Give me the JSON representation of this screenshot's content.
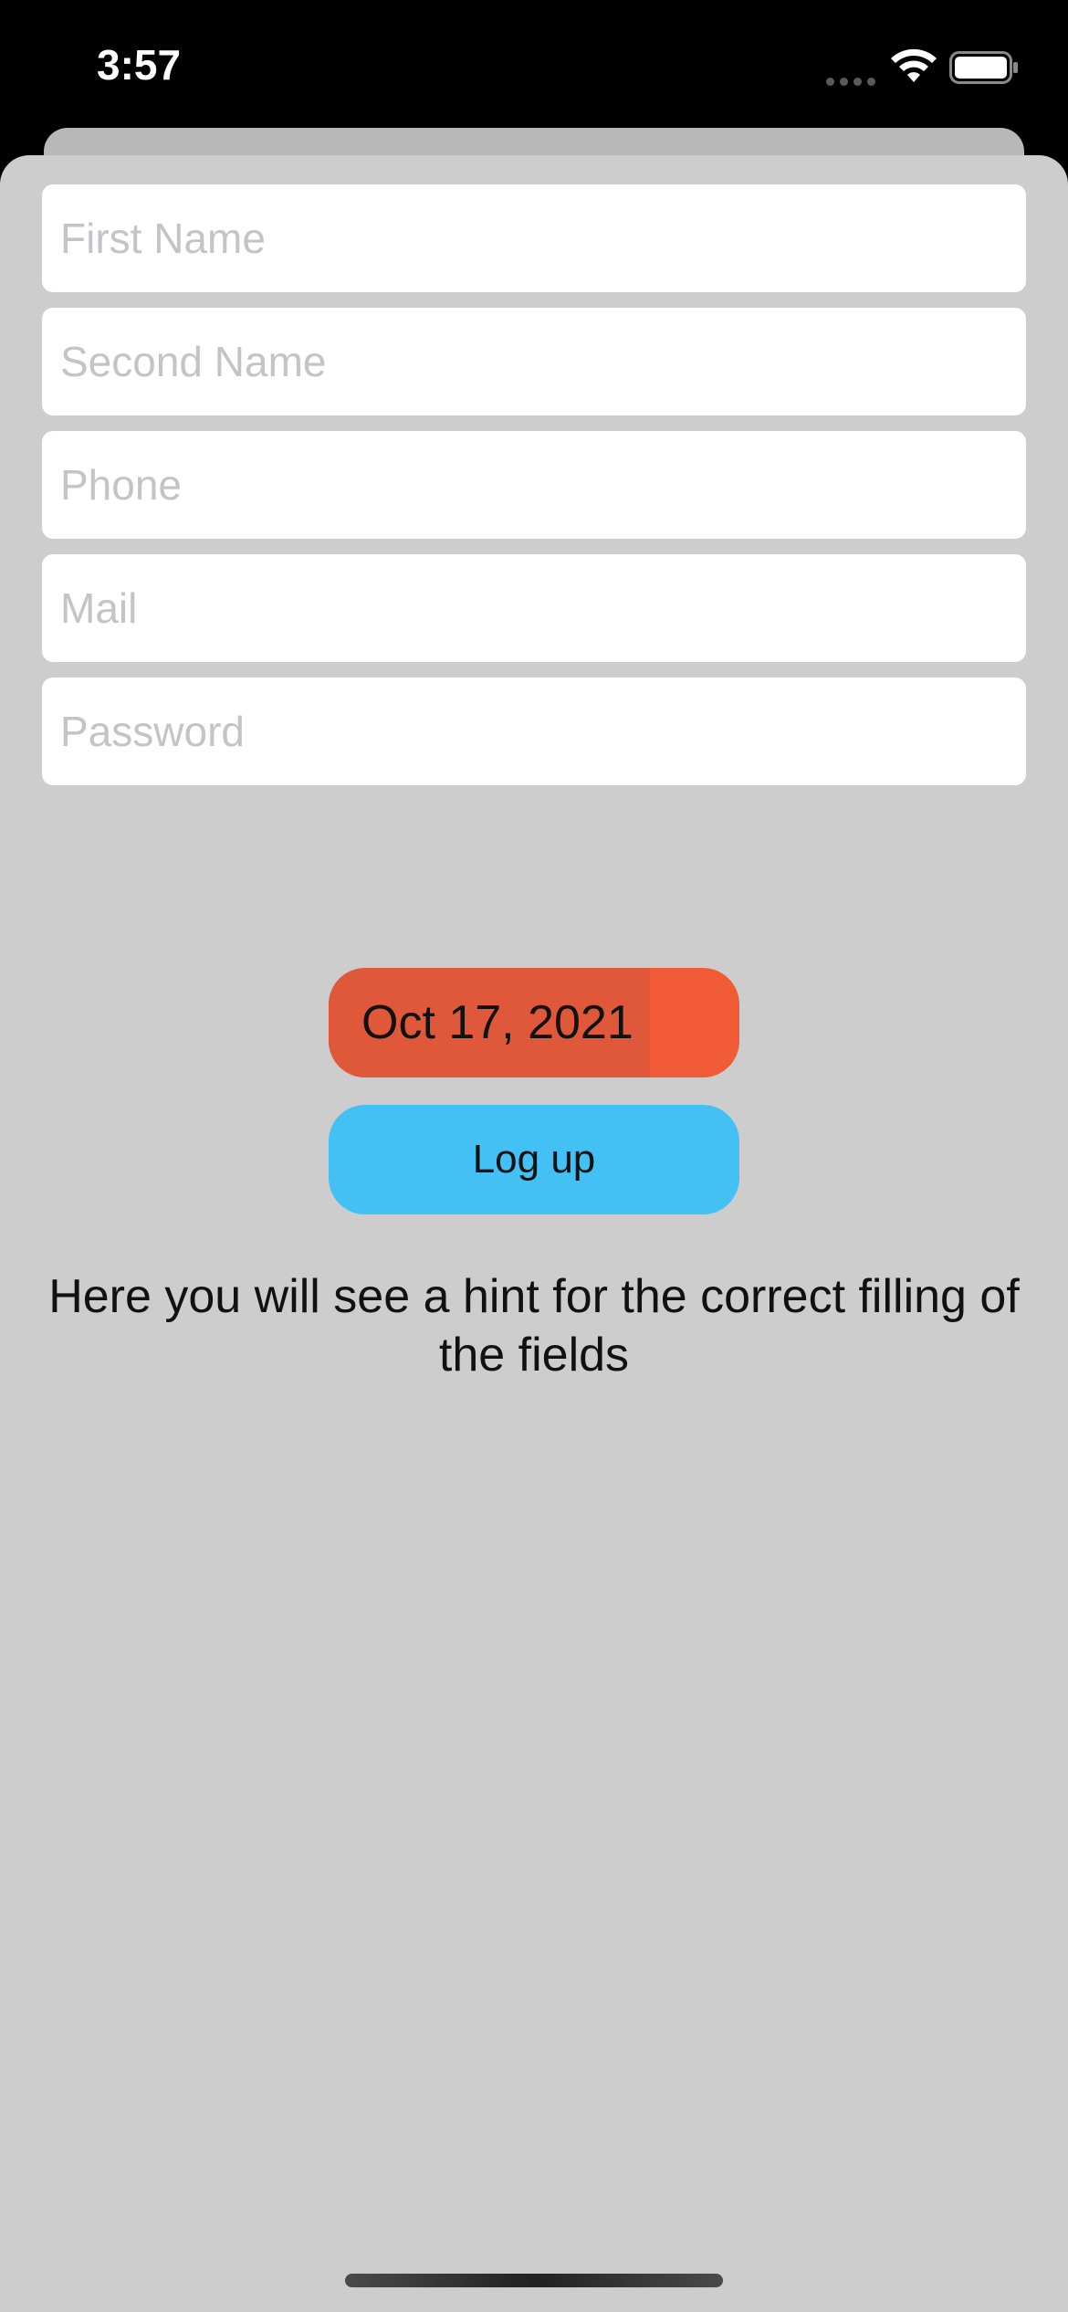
{
  "status_bar": {
    "time": "3:57",
    "icons": [
      "signal-dots-icon",
      "wifi-icon",
      "battery-icon"
    ]
  },
  "form": {
    "first_name": {
      "placeholder": "First Name",
      "value": ""
    },
    "second_name": {
      "placeholder": "Second Name",
      "value": ""
    },
    "phone": {
      "placeholder": "Phone",
      "value": ""
    },
    "mail": {
      "placeholder": "Mail",
      "value": ""
    },
    "password": {
      "placeholder": "Password",
      "value": ""
    },
    "date": "Oct 17, 2021",
    "submit_label": "Log up",
    "hint": "Here you will see a hint for the correct filling of the fields"
  },
  "colors": {
    "background": "#cdcdcd",
    "date_button": "#f05a35",
    "logup_button": "#43c0f4",
    "field": "#ffffff",
    "placeholder": "#c4c4c8"
  }
}
